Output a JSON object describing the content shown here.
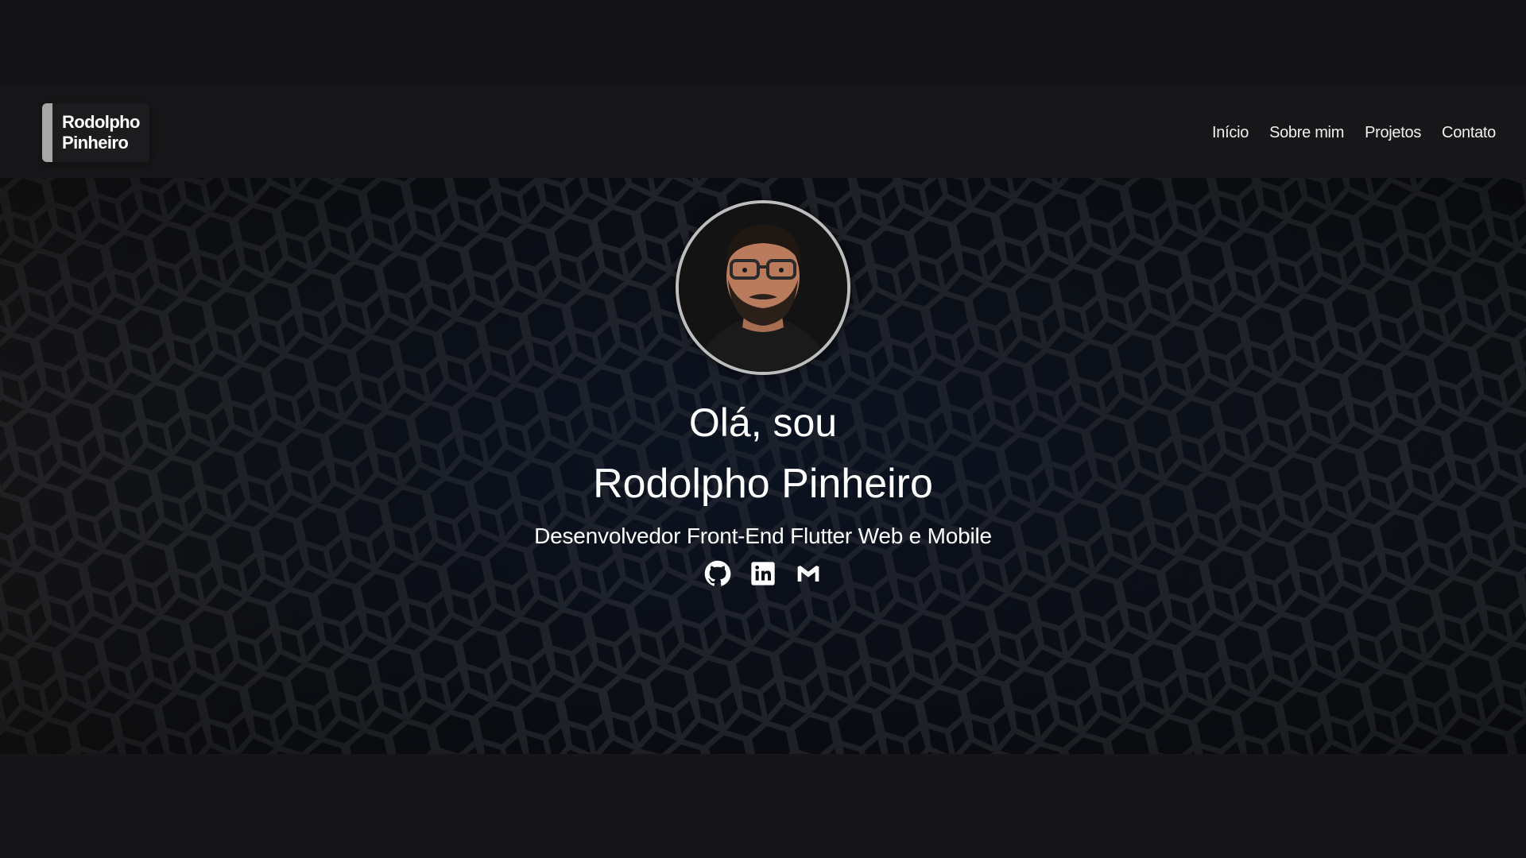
{
  "brand": {
    "line1": "Rodolpho",
    "line2": "Pinheiro"
  },
  "nav": {
    "items": [
      {
        "label": "Início"
      },
      {
        "label": "Sobre mim"
      },
      {
        "label": "Projetos"
      },
      {
        "label": "Contato"
      }
    ]
  },
  "hero": {
    "greeting": "Olá, sou",
    "name": "Rodolpho Pinheiro",
    "subtitle": "Desenvolvedor Front-End Flutter Web e Mobile",
    "socials": [
      {
        "icon": "github-icon"
      },
      {
        "icon": "linkedin-icon"
      },
      {
        "icon": "gmail-icon"
      }
    ]
  },
  "colors": {
    "page_background": "#151517",
    "navbar_background": "#171719",
    "brand_accent": "#a7a7a7",
    "avatar_border": "#bdbdbd",
    "text": "#ffffff"
  }
}
